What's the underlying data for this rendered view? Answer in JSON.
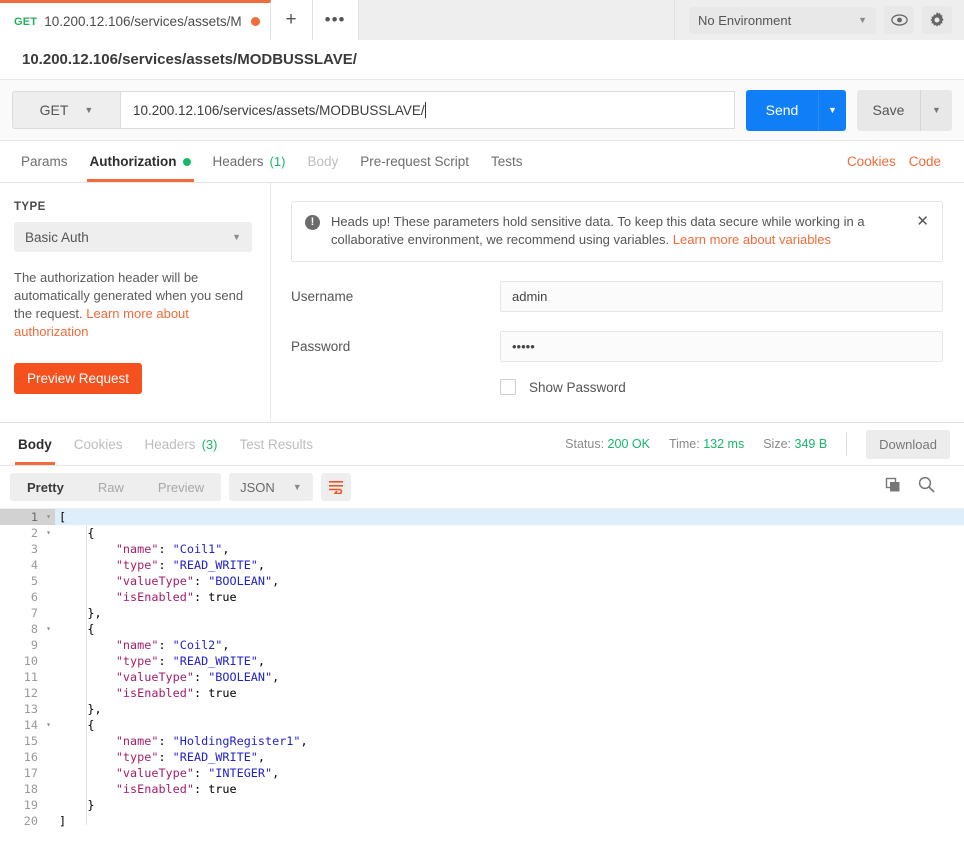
{
  "topbar": {
    "tab": {
      "method": "GET",
      "title": "10.200.12.106/services/assets/M",
      "dirty_indicator": "unsaved-dot"
    },
    "new_tab_label": "+",
    "more_tabs_label": "•••",
    "environment": {
      "selected": "No Environment",
      "caret": "▼"
    },
    "eye_icon": "eye-icon",
    "gear_icon": "gear-icon"
  },
  "request": {
    "title": "10.200.12.106/services/assets/MODBUSSLAVE/",
    "method": "GET",
    "method_caret": "▼",
    "url": "10.200.12.106/services/assets/MODBUSSLAVE/",
    "send_label": "Send",
    "send_caret": "▼",
    "save_label": "Save",
    "save_caret": "▼",
    "tabs": [
      {
        "label": "Params",
        "state": "normal"
      },
      {
        "label": "Authorization",
        "state": "active",
        "badge": "green-dot"
      },
      {
        "label": "Headers",
        "count": "(1)",
        "state": "normal"
      },
      {
        "label": "Body",
        "state": "disabled"
      },
      {
        "label": "Pre-request Script",
        "state": "normal"
      },
      {
        "label": "Tests",
        "state": "normal"
      }
    ],
    "cookies_link": "Cookies",
    "code_link": "Code"
  },
  "authorization": {
    "type_label": "TYPE",
    "type_value": "Basic Auth",
    "type_caret": "▼",
    "description": "The authorization header will be automatically generated when you send the request. ",
    "description_link": "Learn more about authorization",
    "preview_button": "Preview Request",
    "warning": {
      "icon": "alert-icon",
      "text": "Heads up! These parameters hold sensitive data. To keep this data secure while working in a collaborative environment, we recommend using variables. ",
      "link": "Learn more about variables",
      "close": "✕"
    },
    "username_label": "Username",
    "username_value": "admin",
    "password_label": "Password",
    "password_value": "•••••",
    "show_password_label": "Show Password"
  },
  "response": {
    "tabs": [
      {
        "label": "Body",
        "state": "active"
      },
      {
        "label": "Cookies",
        "state": "muted"
      },
      {
        "label": "Headers",
        "count": "(3)",
        "state": "muted"
      },
      {
        "label": "Test Results",
        "state": "muted"
      }
    ],
    "status_label": "Status:",
    "status_value": "200 OK",
    "time_label": "Time:",
    "time_value": "132 ms",
    "size_label": "Size:",
    "size_value": "349 B",
    "download_label": "Download",
    "view_modes": [
      {
        "label": "Pretty",
        "state": "active"
      },
      {
        "label": "Raw",
        "state": "muted"
      },
      {
        "label": "Preview",
        "state": "muted"
      }
    ],
    "format": "JSON",
    "format_caret": "▼",
    "wrap_icon": "word-wrap-icon",
    "copy_icon": "copy-icon",
    "search_icon": "search-icon",
    "colors": {
      "accent": "#f26b3a",
      "send": "#0f7ef7",
      "success": "#19b56b",
      "key": "#a71d6a",
      "string": "#2222cc"
    },
    "body_lines": [
      {
        "n": 1,
        "fold": "▾",
        "highlight": true,
        "tokens": [
          {
            "t": "[",
            "c": "p"
          }
        ]
      },
      {
        "n": 2,
        "fold": "▾",
        "highlight": false,
        "tokens": [
          {
            "t": "    {",
            "c": "p"
          }
        ]
      },
      {
        "n": 3,
        "fold": "",
        "highlight": false,
        "tokens": [
          {
            "t": "        ",
            "c": "p"
          },
          {
            "t": "\"name\"",
            "c": "k"
          },
          {
            "t": ": ",
            "c": "p"
          },
          {
            "t": "\"Coil1\"",
            "c": "s"
          },
          {
            "t": ",",
            "c": "p"
          }
        ]
      },
      {
        "n": 4,
        "fold": "",
        "highlight": false,
        "tokens": [
          {
            "t": "        ",
            "c": "p"
          },
          {
            "t": "\"type\"",
            "c": "k"
          },
          {
            "t": ": ",
            "c": "p"
          },
          {
            "t": "\"READ_WRITE\"",
            "c": "s"
          },
          {
            "t": ",",
            "c": "p"
          }
        ]
      },
      {
        "n": 5,
        "fold": "",
        "highlight": false,
        "tokens": [
          {
            "t": "        ",
            "c": "p"
          },
          {
            "t": "\"valueType\"",
            "c": "k"
          },
          {
            "t": ": ",
            "c": "p"
          },
          {
            "t": "\"BOOLEAN\"",
            "c": "s"
          },
          {
            "t": ",",
            "c": "p"
          }
        ]
      },
      {
        "n": 6,
        "fold": "",
        "highlight": false,
        "tokens": [
          {
            "t": "        ",
            "c": "p"
          },
          {
            "t": "\"isEnabled\"",
            "c": "k"
          },
          {
            "t": ": ",
            "c": "p"
          },
          {
            "t": "true",
            "c": "p"
          }
        ]
      },
      {
        "n": 7,
        "fold": "",
        "highlight": false,
        "tokens": [
          {
            "t": "    },",
            "c": "p"
          }
        ]
      },
      {
        "n": 8,
        "fold": "▾",
        "highlight": false,
        "tokens": [
          {
            "t": "    {",
            "c": "p"
          }
        ]
      },
      {
        "n": 9,
        "fold": "",
        "highlight": false,
        "tokens": [
          {
            "t": "        ",
            "c": "p"
          },
          {
            "t": "\"name\"",
            "c": "k"
          },
          {
            "t": ": ",
            "c": "p"
          },
          {
            "t": "\"Coil2\"",
            "c": "s"
          },
          {
            "t": ",",
            "c": "p"
          }
        ]
      },
      {
        "n": 10,
        "fold": "",
        "highlight": false,
        "tokens": [
          {
            "t": "        ",
            "c": "p"
          },
          {
            "t": "\"type\"",
            "c": "k"
          },
          {
            "t": ": ",
            "c": "p"
          },
          {
            "t": "\"READ_WRITE\"",
            "c": "s"
          },
          {
            "t": ",",
            "c": "p"
          }
        ]
      },
      {
        "n": 11,
        "fold": "",
        "highlight": false,
        "tokens": [
          {
            "t": "        ",
            "c": "p"
          },
          {
            "t": "\"valueType\"",
            "c": "k"
          },
          {
            "t": ": ",
            "c": "p"
          },
          {
            "t": "\"BOOLEAN\"",
            "c": "s"
          },
          {
            "t": ",",
            "c": "p"
          }
        ]
      },
      {
        "n": 12,
        "fold": "",
        "highlight": false,
        "tokens": [
          {
            "t": "        ",
            "c": "p"
          },
          {
            "t": "\"isEnabled\"",
            "c": "k"
          },
          {
            "t": ": ",
            "c": "p"
          },
          {
            "t": "true",
            "c": "p"
          }
        ]
      },
      {
        "n": 13,
        "fold": "",
        "highlight": false,
        "tokens": [
          {
            "t": "    },",
            "c": "p"
          }
        ]
      },
      {
        "n": 14,
        "fold": "▾",
        "highlight": false,
        "tokens": [
          {
            "t": "    {",
            "c": "p"
          }
        ]
      },
      {
        "n": 15,
        "fold": "",
        "highlight": false,
        "tokens": [
          {
            "t": "        ",
            "c": "p"
          },
          {
            "t": "\"name\"",
            "c": "k"
          },
          {
            "t": ": ",
            "c": "p"
          },
          {
            "t": "\"HoldingRegister1\"",
            "c": "s"
          },
          {
            "t": ",",
            "c": "p"
          }
        ]
      },
      {
        "n": 16,
        "fold": "",
        "highlight": false,
        "tokens": [
          {
            "t": "        ",
            "c": "p"
          },
          {
            "t": "\"type\"",
            "c": "k"
          },
          {
            "t": ": ",
            "c": "p"
          },
          {
            "t": "\"READ_WRITE\"",
            "c": "s"
          },
          {
            "t": ",",
            "c": "p"
          }
        ]
      },
      {
        "n": 17,
        "fold": "",
        "highlight": false,
        "tokens": [
          {
            "t": "        ",
            "c": "p"
          },
          {
            "t": "\"valueType\"",
            "c": "k"
          },
          {
            "t": ": ",
            "c": "p"
          },
          {
            "t": "\"INTEGER\"",
            "c": "s"
          },
          {
            "t": ",",
            "c": "p"
          }
        ]
      },
      {
        "n": 18,
        "fold": "",
        "highlight": false,
        "tokens": [
          {
            "t": "        ",
            "c": "p"
          },
          {
            "t": "\"isEnabled\"",
            "c": "k"
          },
          {
            "t": ": ",
            "c": "p"
          },
          {
            "t": "true",
            "c": "p"
          }
        ]
      },
      {
        "n": 19,
        "fold": "",
        "highlight": false,
        "tokens": [
          {
            "t": "    }",
            "c": "p"
          }
        ]
      },
      {
        "n": 20,
        "fold": "",
        "highlight": false,
        "tokens": [
          {
            "t": "]",
            "c": "p"
          }
        ]
      }
    ]
  }
}
